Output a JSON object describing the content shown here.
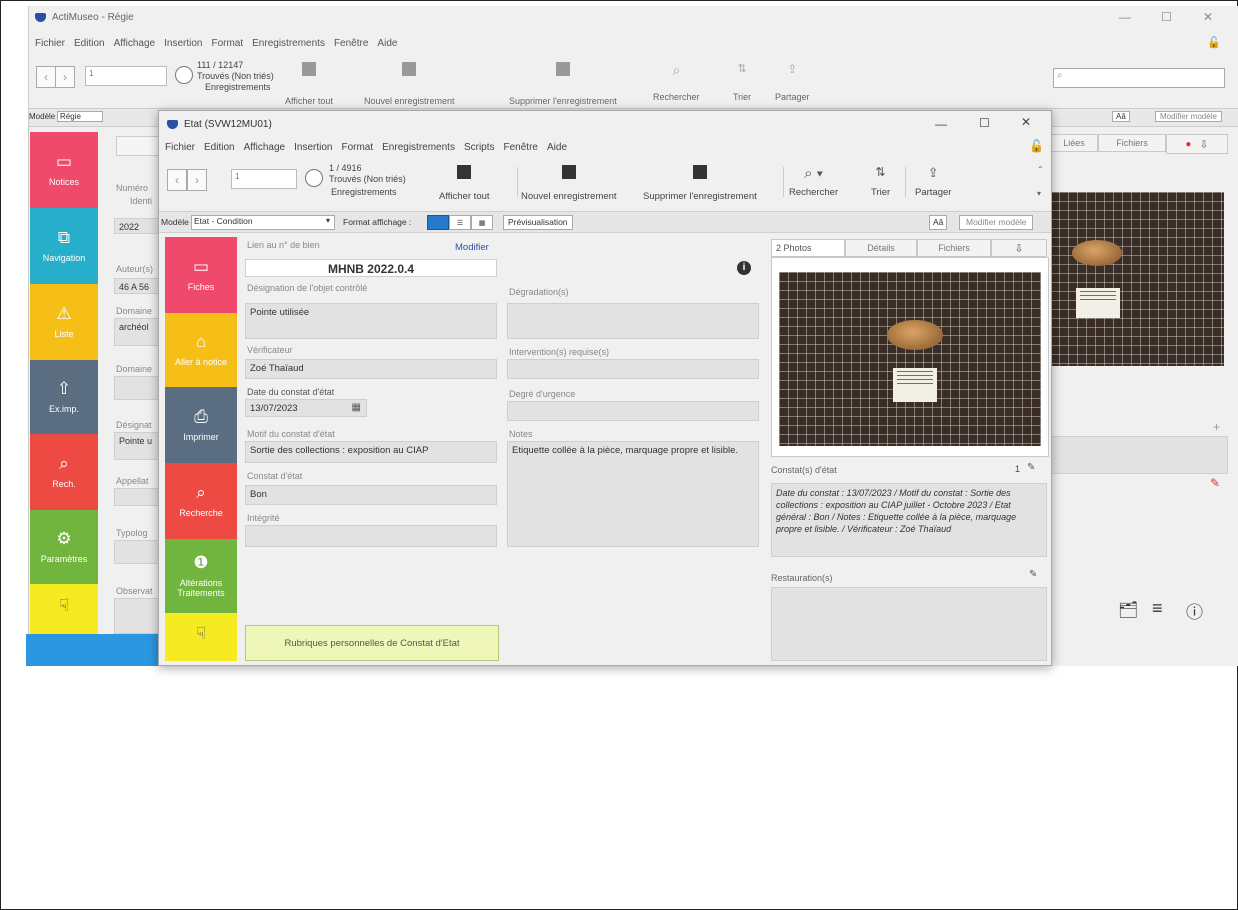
{
  "bg": {
    "title": "ActiMuseo - Régie",
    "menu": [
      "Fichier",
      "Edition",
      "Affichage",
      "Insertion",
      "Format",
      "Enregistrements",
      "Fenêtre",
      "Aide"
    ],
    "record_count": "111 / 12147",
    "found": "Trouvés (Non triés)",
    "records_label": "Enregistrements",
    "slider_value": "1",
    "toolbar": [
      "Afficher tout",
      "Nouvel enregistrement",
      "Supprimer l'enregistrement",
      "Rechercher",
      "Trier",
      "Partager"
    ],
    "model_label": "Modèle :",
    "model_value": "Régie",
    "aa": "Aâ",
    "modify_model": "Modifier modèle",
    "side": [
      "Notices",
      "Navigation",
      "Liste",
      "Ex.imp.",
      "Rech.",
      "Paramètres",
      ""
    ],
    "side_icons": {
      "notices": "calendar-icon",
      "navigation": "copy-icon",
      "liste": "warning-icon",
      "eximp": "export-icon",
      "rech": "search-icon",
      "params": "gear-icon",
      "last": "cursor-icon"
    },
    "field_labels": [
      "Numéro",
      "Identi",
      "Auteur(s)",
      "Domaine",
      "Domaine",
      "Désignat",
      "Appellat",
      "Typolog",
      "Observat"
    ],
    "field_values": [
      "2022",
      "46 A 56",
      "archéol",
      "Pointe u"
    ],
    "tabs": [
      "Liées",
      "Fichiers"
    ],
    "side_colors": {
      "notices": "#ef4a6b",
      "navigation": "#27aeca",
      "liste": "#f6bf18",
      "eximp": "#5b6d80",
      "rech": "#ec4a42",
      "params": "#71b53e",
      "last": "#f6eb22"
    }
  },
  "front": {
    "title": "Etat (SVW12MU01)",
    "menu": [
      "Fichier",
      "Edition",
      "Affichage",
      "Insertion",
      "Format",
      "Enregistrements",
      "Scripts",
      "Fenêtre",
      "Aide"
    ],
    "slider_value": "1",
    "record_count": "1 / 4916",
    "found": "Trouvés (Non triés)",
    "records_label": "Enregistrements",
    "toolbar": {
      "show_all": "Afficher tout",
      "new_record": "Nouvel enregistrement",
      "delete_record": "Supprimer l'enregistrement",
      "search": "Rechercher",
      "sort": "Trier",
      "share": "Partager"
    },
    "model_label": "Modèle :",
    "model_value": "Etat - Condition",
    "format_label": "Format affichage :",
    "preview": "Prévisualisation",
    "aa": "Aâ",
    "modify_model": "Modifier modèle",
    "side": {
      "fiches": "Fiches",
      "aller": "Aller à notice",
      "imprimer": "Imprimer",
      "recherche": "Recherche",
      "alterations": "Altérations Traitements"
    },
    "side_colors": {
      "fiches": "#ef4a6b",
      "aller": "#f6bf18",
      "imprimer": "#5b6d80",
      "recherche": "#ec4a42",
      "alterations": "#71b53e",
      "last": "#f6eb22"
    },
    "form": {
      "lien_label": "Lien au n° de bien",
      "modifier": "Modifier",
      "inventory": "MHNB 2022.0.4",
      "designation_label": "Désignation de l'objet contrôlé",
      "designation": "Pointe utilisée",
      "degradation_label": "Dégradation(s)",
      "degradation": "",
      "verificateur_label": "Vérificateur",
      "verificateur": "Zoé Thaïaud",
      "intervention_label": "Intervention(s) requise(s)",
      "intervention": "",
      "date_label": "Date du constat d'état",
      "date": "13/07/2023",
      "urgence_label": "Degré d'urgence",
      "urgence": "",
      "motif_label": "Motif du constat d'état",
      "motif": "Sortie des collections : exposition au CIAP",
      "notes_label": "Notes",
      "notes": "Etiquette collée à la pièce, marquage propre et lisible.",
      "constat_label": "Constat d'état",
      "constat": "Bon",
      "integrite_label": "Intégrité",
      "integrite": "",
      "rubriques": "Rubriques personnelles de Constat d'Etat"
    },
    "right": {
      "tabs": [
        "2  Photos",
        "Détails",
        "Fichiers"
      ],
      "constats_label": "Constat(s) d'état",
      "constats_count": "1",
      "constats_text": "Date du constat : 13/07/2023 / Motif du constat : Sortie des collections : exposition au CIAP juillet - Octobre 2023 / Etat général : Bon / Notes : Etiquette collée à la pièce, marquage propre et lisible. / Vérificateur : Zoé Thaïaud",
      "restaurations_label": "Restauration(s)"
    }
  }
}
